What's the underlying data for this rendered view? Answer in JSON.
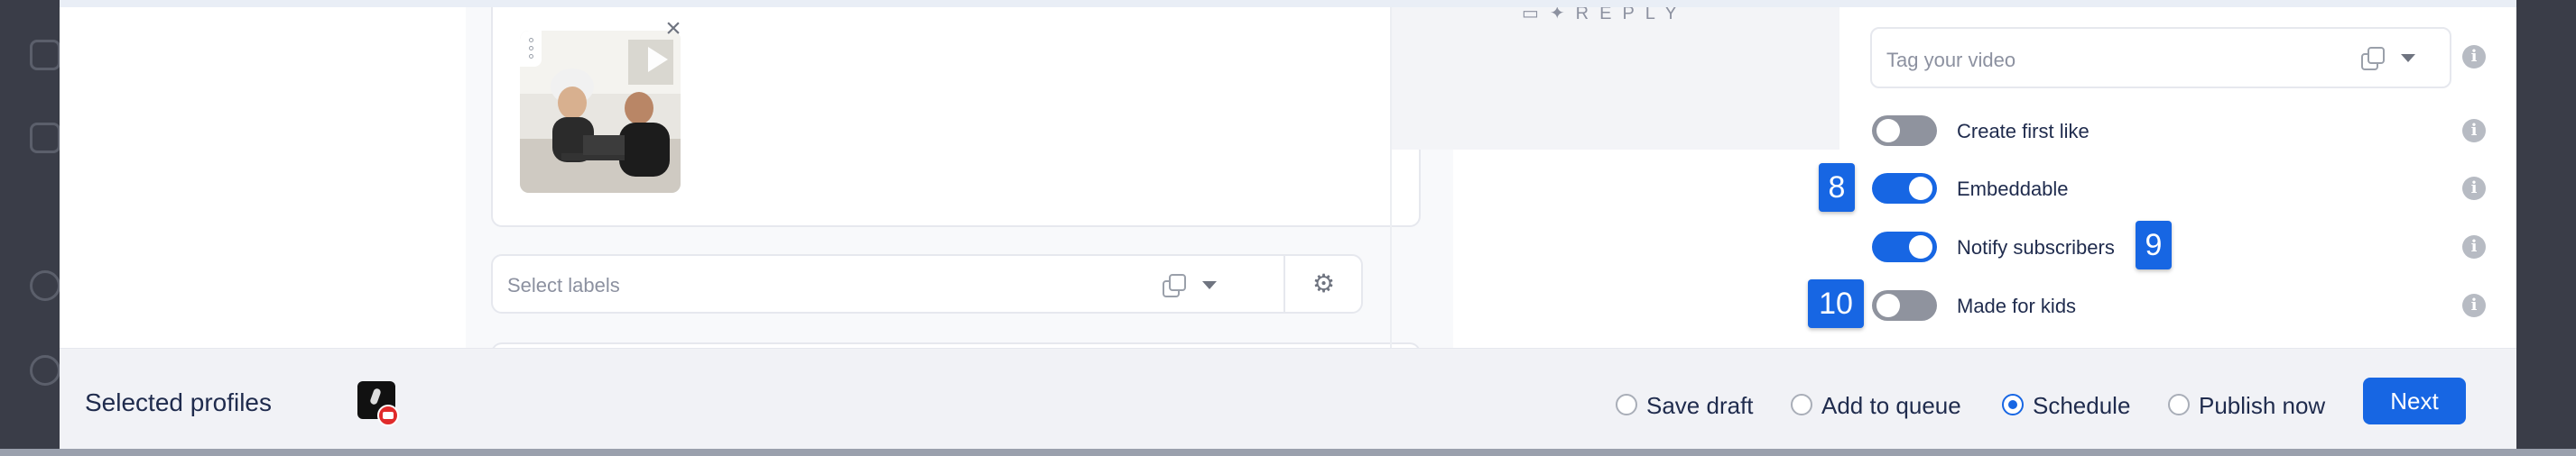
{
  "left_panel": {
    "labels_placeholder": "Select labels"
  },
  "right_panel": {
    "tag_placeholder": "Tag your video",
    "toggles": [
      {
        "label": "Create first like",
        "on": false
      },
      {
        "label": "Embeddable",
        "on": true
      },
      {
        "label": "Notify subscribers",
        "on": true
      },
      {
        "label": "Made for kids",
        "on": false
      }
    ],
    "preview_text": "REPLY"
  },
  "markers": [
    "8",
    "9",
    "10"
  ],
  "footer": {
    "title": "Selected profiles",
    "options": [
      {
        "label": "Save draft",
        "checked": false
      },
      {
        "label": "Add to queue",
        "checked": false
      },
      {
        "label": "Schedule",
        "checked": true
      },
      {
        "label": "Publish now",
        "checked": false
      }
    ],
    "next_label": "Next"
  },
  "colors": {
    "accent": "#1766e3",
    "toggle_off": "#8f939e",
    "youtube": "#e02b2b"
  },
  "icons": [
    "close-icon",
    "play-icon",
    "drag-handle-icon",
    "copy-icon",
    "chevron-down-icon",
    "gear-icon",
    "info-icon",
    "youtube-icon"
  ]
}
